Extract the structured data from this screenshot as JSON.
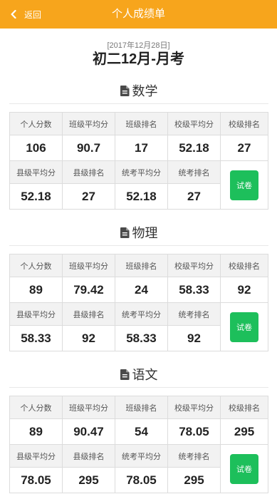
{
  "header": {
    "back_icon": "chevron-left-icon",
    "back_label": "返回",
    "title": "个人成绩单"
  },
  "exam": {
    "date": "[2017年12月28日]",
    "title": "初二12月-月考"
  },
  "score_table": {
    "row1_labels": [
      "个人分数",
      "班级平均分",
      "班级排名",
      "校级平均分",
      "校级排名"
    ],
    "row2_labels": [
      "县级平均分",
      "县级排名",
      "统考平均分",
      "统考排名"
    ]
  },
  "subjects": [
    {
      "name": "数学",
      "icon": "document-icon",
      "row1_values": [
        "106",
        "90.7",
        "17",
        "52.18",
        "27"
      ],
      "row2_values": [
        "52.18",
        "27",
        "52.18",
        "27"
      ],
      "paper_button": "试卷"
    },
    {
      "name": "物理",
      "icon": "document-icon",
      "row1_values": [
        "89",
        "79.42",
        "24",
        "58.33",
        "92"
      ],
      "row2_values": [
        "58.33",
        "92",
        "58.33",
        "92"
      ],
      "paper_button": "试卷"
    },
    {
      "name": "语文",
      "icon": "document-icon",
      "row1_values": [
        "89",
        "90.47",
        "54",
        "78.05",
        "295"
      ],
      "row2_values": [
        "78.05",
        "295",
        "78.05",
        "295"
      ],
      "paper_button": "试卷"
    }
  ],
  "colors": {
    "header": "#F7A51C",
    "paper_button": "#1DBF5B",
    "label_cell": "#F2F2F2"
  }
}
